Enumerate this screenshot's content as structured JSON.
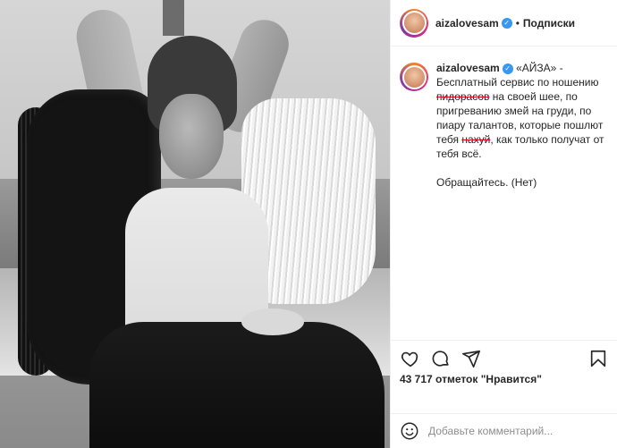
{
  "post": {
    "author": "aizalovesam",
    "follow_label": "Подписки",
    "separator": "•",
    "caption": {
      "part1": "«АЙЗА» - Бесплатный сервис по ношению ",
      "struck1": "пидорасов",
      "part2": " на своей шее, по пригреванию змей на груди, по пиару талантов, которые пошлют тебя ",
      "struck2": "нахуй",
      "part3": ", как только получат от тебя всё.",
      "paragraph2": "Обращайтесь. (Нет)"
    },
    "likes": "43 717 отметок \"Нравится\"",
    "comment_placeholder": "Добавьте комментарий..."
  },
  "icons": {
    "verified": "verified-badge-icon",
    "like": "heart-icon",
    "comment": "comment-icon",
    "share": "share-icon",
    "save": "bookmark-icon",
    "emoji": "emoji-icon"
  },
  "colors": {
    "verified": "#3897f0",
    "strike": "#d0021b",
    "text": "#262626",
    "muted": "#8e8e8e"
  }
}
